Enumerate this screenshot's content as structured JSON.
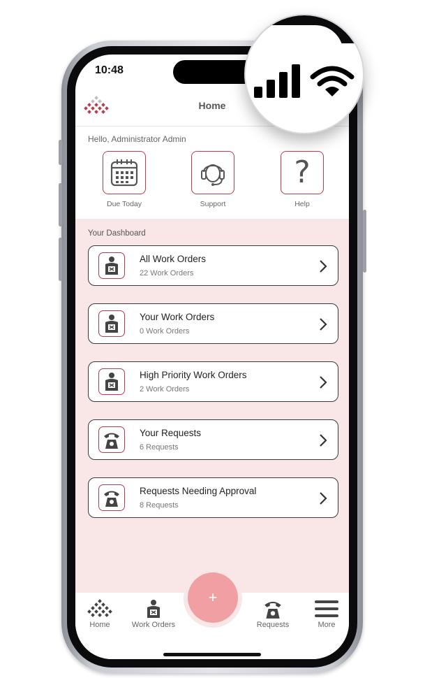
{
  "status": {
    "time": "10:48"
  },
  "header": {
    "title": "Home"
  },
  "greeting": "Hello, Administrator Admin",
  "quick_actions": [
    {
      "label": "Due Today",
      "icon": "calendar-icon"
    },
    {
      "label": "Support",
      "icon": "headset-icon"
    },
    {
      "label": "Help",
      "icon": "question-icon",
      "glyph": "?"
    }
  ],
  "dashboard": {
    "title": "Your Dashboard",
    "cards": [
      {
        "title": "All Work Orders",
        "subtitle": "22 Work Orders",
        "icon": "work-order-icon"
      },
      {
        "title": "Your Work Orders",
        "subtitle": "0 Work Orders",
        "icon": "work-order-icon"
      },
      {
        "title": "High Priority Work Orders",
        "subtitle": "2 Work Orders",
        "icon": "work-order-icon"
      },
      {
        "title": "Your Requests",
        "subtitle": "6 Requests",
        "icon": "request-phone-icon"
      },
      {
        "title": "Requests Needing Approval",
        "subtitle": "8 Requests",
        "icon": "request-phone-icon"
      }
    ]
  },
  "tabbar": {
    "items": [
      {
        "label": "Home",
        "icon": "home-logo-icon"
      },
      {
        "label": "Work Orders",
        "icon": "work-order-icon"
      },
      {
        "label": "Requests",
        "icon": "request-phone-icon"
      },
      {
        "label": "More",
        "icon": "menu-icon"
      }
    ],
    "fab_label": "+"
  },
  "colors": {
    "accent": "#b83c4f",
    "dashboard_bg": "#f9e7e7",
    "fab": "#f0a0a2"
  }
}
